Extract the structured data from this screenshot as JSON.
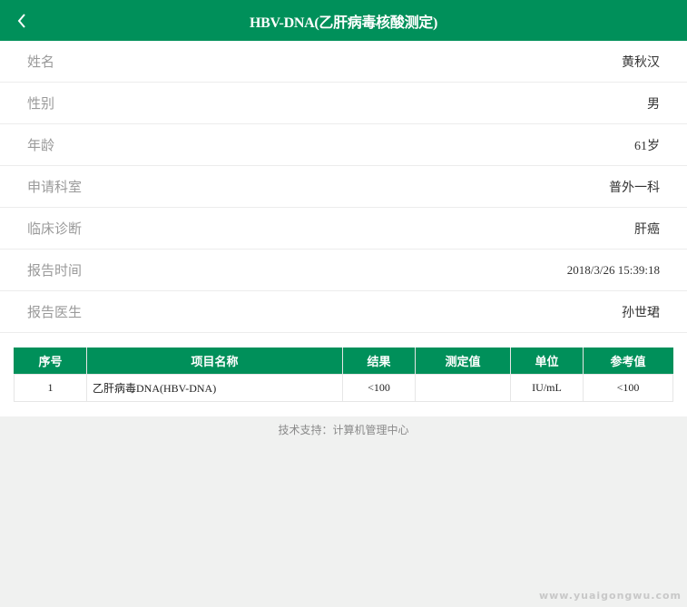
{
  "header": {
    "title": "HBV-DNA(乙肝病毒核酸测定)",
    "back_icon": "chevron-left-icon"
  },
  "patient": {
    "rows": [
      {
        "label": "姓名",
        "value": "黄秋汉"
      },
      {
        "label": "性别",
        "value": "男"
      },
      {
        "label": "年龄",
        "value": "61岁"
      },
      {
        "label": "申请科室",
        "value": "普外一科"
      },
      {
        "label": "临床诊断",
        "value": "肝癌"
      },
      {
        "label": "报告时间",
        "value": "2018/3/26 15:39:18"
      },
      {
        "label": "报告医生",
        "value": "孙世珺"
      }
    ]
  },
  "results": {
    "columns": [
      "序号",
      "项目名称",
      "结果",
      "测定值",
      "单位",
      "参考值"
    ],
    "rows": [
      {
        "index": "1",
        "name": "乙肝病毒DNA(HBV-DNA)",
        "result": "<100",
        "measured": "",
        "unit": "IU/mL",
        "reference": "<100"
      }
    ]
  },
  "footer": {
    "text": "技术支持：计算机管理中心"
  },
  "watermark": "www.yuaigongwu.com",
  "colors": {
    "brand": "#00905a",
    "background": "#f0f1f0"
  }
}
